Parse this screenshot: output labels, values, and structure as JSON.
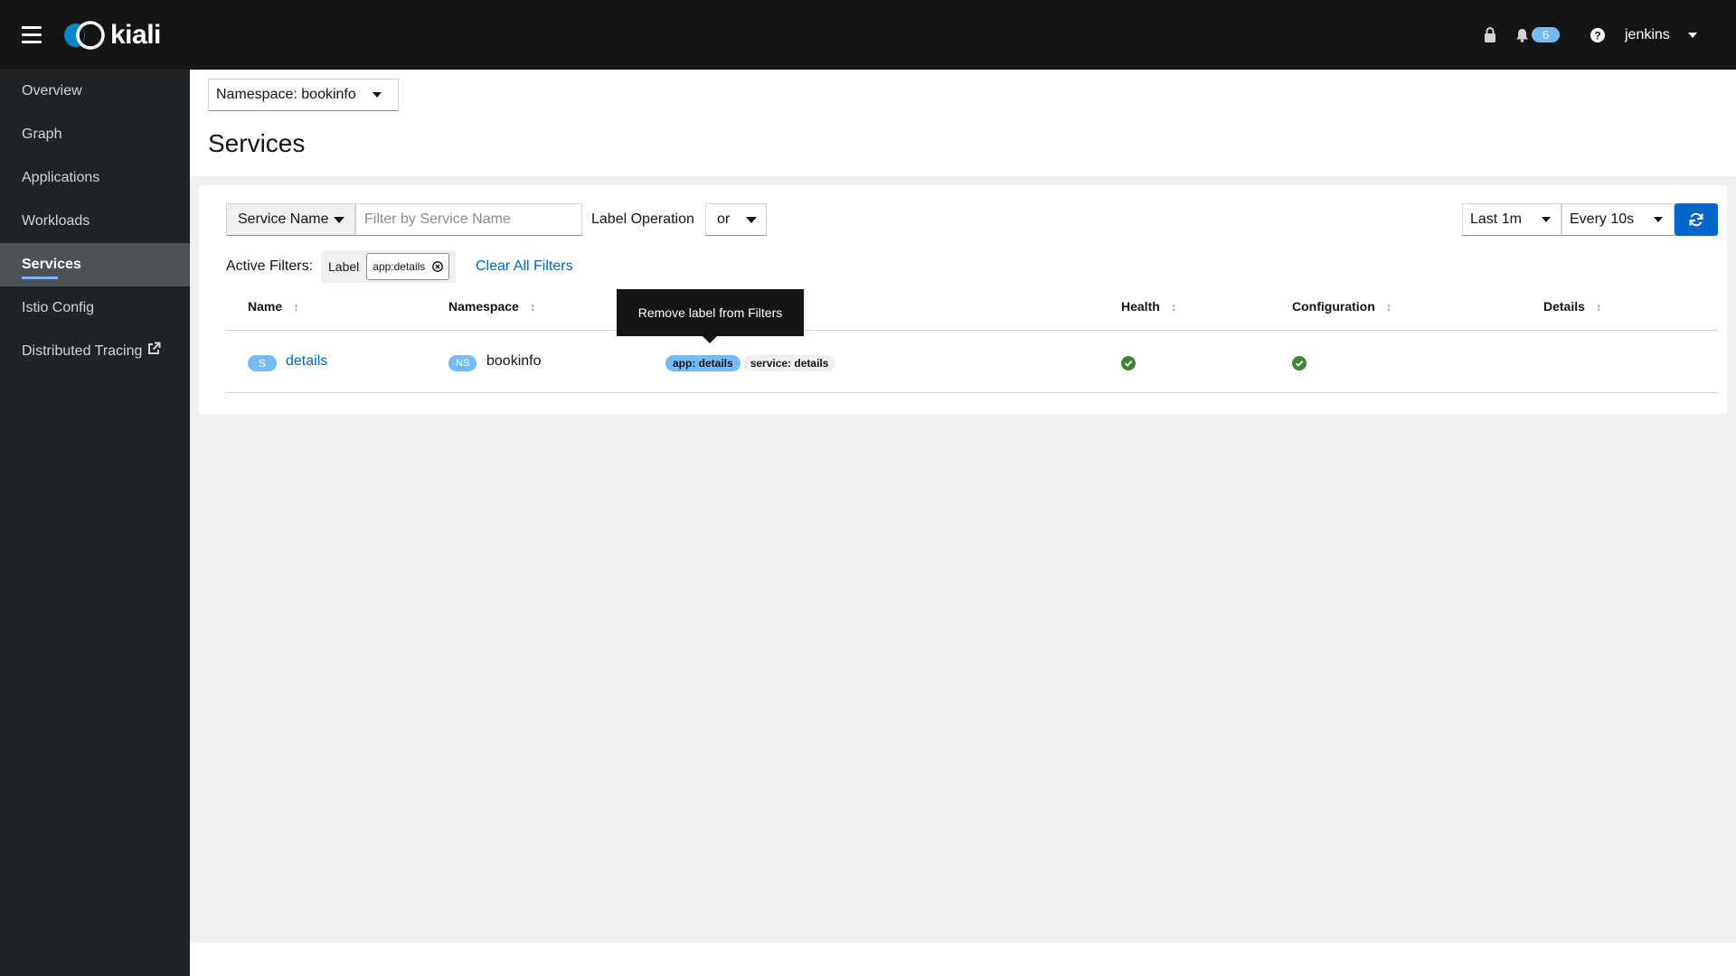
{
  "app": {
    "name": "kiali"
  },
  "masthead": {
    "notification_count": "6",
    "user": "jenkins"
  },
  "sidebar": {
    "items": [
      {
        "label": "Overview"
      },
      {
        "label": "Graph"
      },
      {
        "label": "Applications"
      },
      {
        "label": "Workloads"
      },
      {
        "label": "Services",
        "active": true
      },
      {
        "label": "Istio Config"
      },
      {
        "label": "Distributed Tracing"
      }
    ]
  },
  "header": {
    "namespace_select": "Namespace: bookinfo",
    "title": "Services"
  },
  "toolbar": {
    "filter_type": "Service Name",
    "filter_placeholder": "Filter by Service Name",
    "label_operation": "Label Operation",
    "label_operation_value": "or",
    "time_range": "Last 1m",
    "refresh_interval": "Every 10s"
  },
  "active_filters": {
    "label": "Active Filters:",
    "group_label": "Label",
    "chip": "app:details",
    "clear_all": "Clear All Filters"
  },
  "table": {
    "columns": [
      "Name",
      "Namespace",
      "Health",
      "Configuration",
      "Details"
    ],
    "tooltip": "Remove label from Filters",
    "rows": [
      {
        "badge": "S",
        "name": "details",
        "namespace_badge": "NS",
        "namespace": "bookinfo",
        "labels": [
          "app: details",
          "service: details"
        ],
        "health": "healthy",
        "configuration": "valid"
      }
    ]
  },
  "colors": {
    "masthead": "#151515",
    "sidebar": "#212427",
    "primary": "#0066cc",
    "badge": "#73bcf7",
    "success": "#3e8635"
  }
}
